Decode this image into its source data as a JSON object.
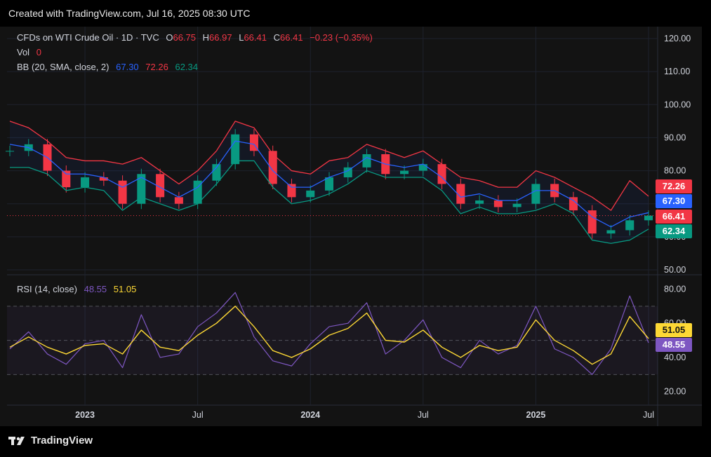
{
  "header": {
    "created": "Created with TradingView.com, Jul 16, 2025 08:30 UTC"
  },
  "legend": {
    "symbol": "CFDs on WTI Crude Oil · 1D · TVC",
    "o_label": "O",
    "o": "66.75",
    "h_label": "H",
    "h": "66.97",
    "l_label": "L",
    "l": "66.41",
    "c_label": "C",
    "c": "66.41",
    "change": "−0.23 (−0.35%)",
    "vol_label": "Vol",
    "vol": "0",
    "bb_label": "BB (20, SMA, close, 2)",
    "bb_basis": "67.30",
    "bb_upper": "72.26",
    "bb_lower": "62.34",
    "rsi_label": "RSI (14, close)",
    "rsi": "48.55",
    "rsi_ma": "51.05"
  },
  "price_tags": {
    "upper": "72.26",
    "basis": "67.30",
    "last": "66.41",
    "lower": "62.34"
  },
  "rsi_tags": {
    "ma": "51.05",
    "rsi": "48.55"
  },
  "footer": {
    "brand": "TradingView"
  },
  "colors": {
    "upper": "#f23645",
    "basis": "#2962ff",
    "lower": "#089981",
    "candle_up": "#089981",
    "candle_down": "#f23645",
    "rsi": "#7e57c2",
    "rsi_ma": "#fdd835",
    "background": "#131313"
  },
  "chart_data": [
    {
      "type": "line",
      "title": "CFDs on WTI Crude Oil · 1D · TVC",
      "x_ticks": [
        "2023",
        "Jul",
        "2024",
        "Jul",
        "2025",
        "Jul"
      ],
      "y_ticks": [
        "120.00",
        "110.00",
        "100.00",
        "90.00",
        "80.00",
        "70.00",
        "60.00",
        "50.00"
      ],
      "ylim": [
        50,
        120
      ],
      "x": [
        "2022-09",
        "2022-10",
        "2022-11",
        "2022-12",
        "2023-01",
        "2023-02",
        "2023-03",
        "2023-04",
        "2023-05",
        "2023-06",
        "2023-07",
        "2023-08",
        "2023-09",
        "2023-10",
        "2023-11",
        "2023-12",
        "2024-01",
        "2024-02",
        "2024-03",
        "2024-04",
        "2024-05",
        "2024-06",
        "2024-07",
        "2024-08",
        "2024-09",
        "2024-10",
        "2024-11",
        "2024-12",
        "2025-01",
        "2025-02",
        "2025-03",
        "2025-04",
        "2025-05",
        "2025-06",
        "2025-07"
      ],
      "series": [
        {
          "name": "Close",
          "values": [
            86,
            88,
            80,
            75,
            78,
            77,
            70,
            79,
            72,
            70,
            77,
            82,
            91,
            86,
            76,
            72,
            74,
            78,
            81,
            85,
            79,
            80,
            82,
            76,
            70,
            71,
            69,
            70,
            76,
            72,
            68,
            61,
            62,
            65,
            66.41
          ]
        },
        {
          "name": "Upper",
          "values": [
            95,
            93,
            89,
            84,
            83,
            83,
            82,
            84,
            80,
            76,
            80,
            86,
            95,
            93,
            85,
            80,
            79,
            83,
            84,
            88,
            86,
            84,
            86,
            82,
            78,
            77,
            75,
            75,
            80,
            78,
            75,
            72,
            68,
            77,
            72.26
          ]
        },
        {
          "name": "Basis",
          "values": [
            88,
            87,
            84,
            79,
            79,
            78,
            75,
            78,
            75,
            72,
            75,
            81,
            89,
            88,
            80,
            75,
            75,
            78,
            80,
            84,
            82,
            81,
            82,
            78,
            72,
            73,
            71,
            71,
            74,
            74,
            71,
            66,
            63,
            66,
            67.3
          ]
        },
        {
          "name": "Lower",
          "values": [
            81,
            81,
            79,
            74,
            75,
            74,
            68,
            72,
            70,
            68,
            70,
            76,
            83,
            83,
            75,
            70,
            71,
            73,
            76,
            80,
            78,
            78,
            78,
            74,
            67,
            69,
            67,
            67,
            68,
            70,
            67,
            59,
            58,
            59,
            62.34
          ]
        }
      ]
    },
    {
      "type": "line",
      "title": "RSI (14, close)",
      "y_ticks": [
        "80.00",
        "60.00",
        "40.00",
        "20.00"
      ],
      "ylim": [
        17,
        81
      ],
      "bands": [
        70,
        50,
        30
      ],
      "x": [
        "2022-09",
        "2022-10",
        "2022-11",
        "2022-12",
        "2023-01",
        "2023-02",
        "2023-03",
        "2023-04",
        "2023-05",
        "2023-06",
        "2023-07",
        "2023-08",
        "2023-09",
        "2023-10",
        "2023-11",
        "2023-12",
        "2024-01",
        "2024-02",
        "2024-03",
        "2024-04",
        "2024-05",
        "2024-06",
        "2024-07",
        "2024-08",
        "2024-09",
        "2024-10",
        "2024-11",
        "2024-12",
        "2025-01",
        "2025-02",
        "2025-03",
        "2025-04",
        "2025-05",
        "2025-06",
        "2025-07"
      ],
      "series": [
        {
          "name": "RSI",
          "values": [
            45,
            55,
            42,
            36,
            48,
            50,
            34,
            65,
            40,
            42,
            58,
            66,
            78,
            52,
            38,
            35,
            48,
            58,
            60,
            72,
            42,
            50,
            62,
            40,
            34,
            50,
            42,
            47,
            70,
            45,
            40,
            30,
            45,
            76,
            48.55
          ]
        },
        {
          "name": "RSI MA",
          "values": [
            46,
            52,
            46,
            42,
            47,
            48,
            42,
            56,
            46,
            44,
            53,
            60,
            70,
            58,
            44,
            40,
            45,
            53,
            57,
            66,
            50,
            49,
            56,
            46,
            40,
            47,
            44,
            46,
            62,
            50,
            44,
            36,
            42,
            64,
            51.05
          ]
        }
      ]
    }
  ]
}
